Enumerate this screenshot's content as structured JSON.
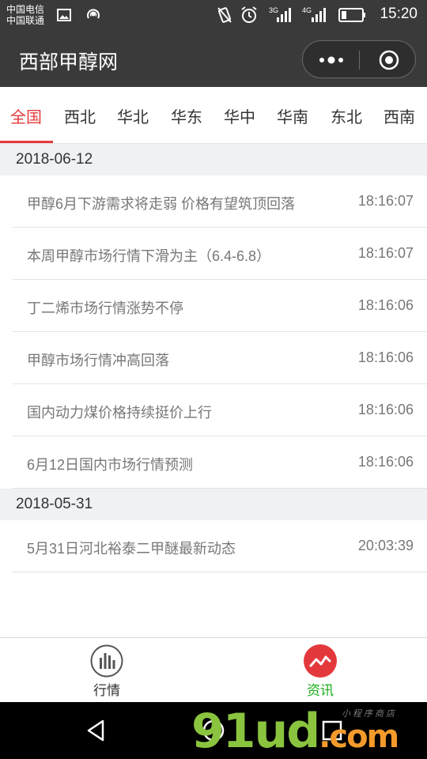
{
  "status_bar": {
    "carrier_1": "中国电信",
    "carrier_2": "中国联通",
    "network_1": "3G",
    "network_2": "4G",
    "time": "15:20"
  },
  "title_bar": {
    "title": "西部甲醇网"
  },
  "tabs": {
    "items": [
      "全国",
      "西北",
      "华北",
      "华东",
      "华中",
      "华南",
      "东北",
      "西南"
    ],
    "active_index": 0
  },
  "news": {
    "groups": [
      {
        "date": "2018-06-12",
        "items": [
          {
            "title": "甲醇6月下游需求将走弱 价格有望筑顶回落",
            "time": "18:16:07"
          },
          {
            "title": "本周甲醇市场行情下滑为主（6.4-6.8）",
            "time": "18:16:07"
          },
          {
            "title": "丁二烯市场行情涨势不停",
            "time": "18:16:06"
          },
          {
            "title": "甲醇市场行情冲高回落",
            "time": "18:16:06"
          },
          {
            "title": "国内动力煤价格持续挺价上行",
            "time": "18:16:06"
          },
          {
            "title": "6月12日国内市场行情预测",
            "time": "18:16:06"
          }
        ]
      },
      {
        "date": "2018-05-31",
        "items": [
          {
            "title": "5月31日河北裕泰二甲醚最新动态",
            "time": "20:03:39"
          }
        ]
      }
    ]
  },
  "bottom_bar": {
    "market_label": "行情",
    "news_label": "资讯",
    "active": "news"
  },
  "watermark": {
    "main": "91ud",
    "suffix": ".com",
    "small": "小程序商店"
  },
  "colors": {
    "accent": "#e4393c",
    "header_bg": "#3a3a3a",
    "active_green": "#1aad19",
    "date_bg": "#eff1f3"
  }
}
